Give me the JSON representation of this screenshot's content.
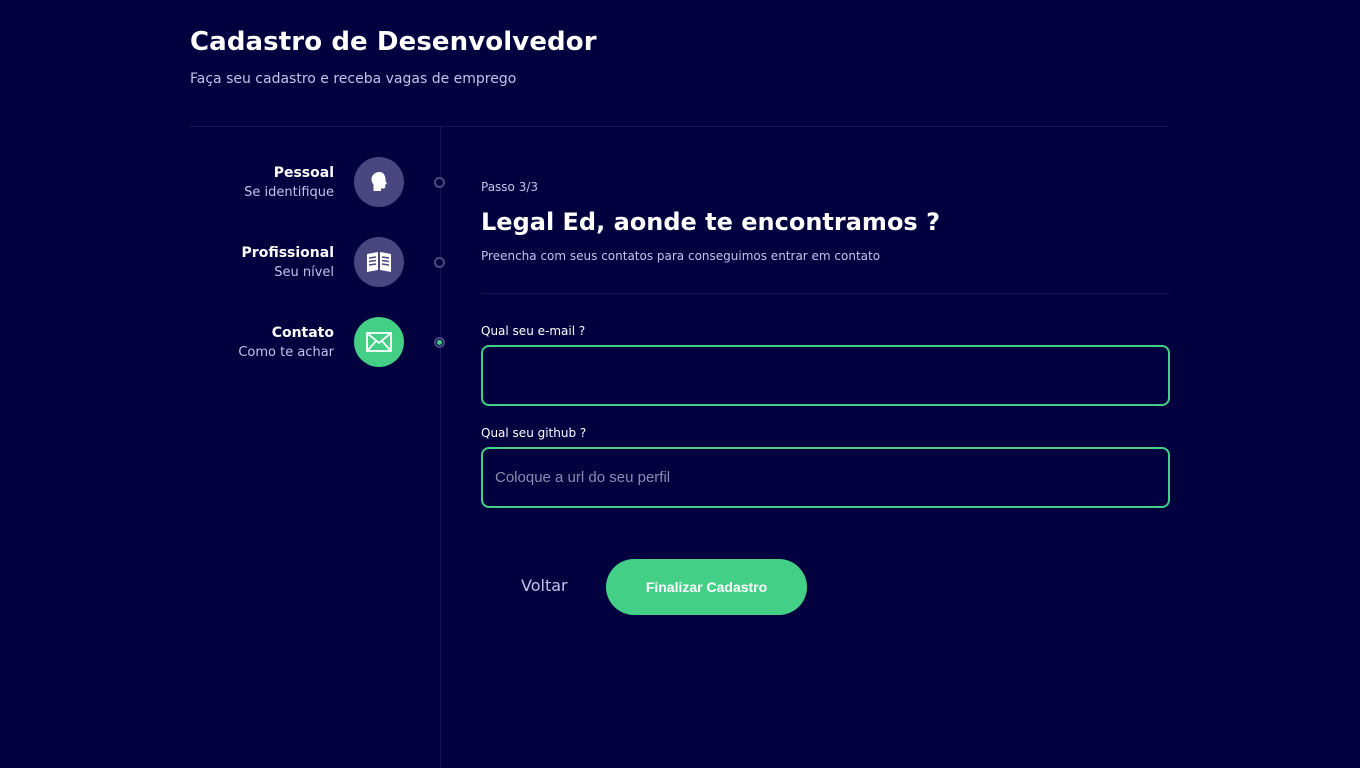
{
  "header": {
    "title": "Cadastro de Desenvolvedor",
    "subtitle": "Faça seu cadastro e receba vagas de emprego"
  },
  "steps": [
    {
      "title": "Pessoal",
      "subtitle": "Se identifique",
      "icon": "head-icon",
      "active": false
    },
    {
      "title": "Profissional",
      "subtitle": "Seu nível",
      "icon": "book-icon",
      "active": false
    },
    {
      "title": "Contato",
      "subtitle": "Como te achar",
      "icon": "envelope-icon",
      "active": true
    }
  ],
  "form": {
    "step_count": "Passo 3/3",
    "title": "Legal Ed, aonde te encontramos ?",
    "description": "Preencha com seus contatos para conseguimos entrar em contato",
    "email": {
      "label": "Qual seu e-mail ?",
      "value": "",
      "placeholder": ""
    },
    "github": {
      "label": "Qual seu github ?",
      "value": "",
      "placeholder": "Coloque a url do seu perfil"
    }
  },
  "actions": {
    "back_label": "Voltar",
    "finish_label": "Finalizar Cadastro"
  },
  "colors": {
    "background": "#02003f",
    "accent": "#43d086",
    "muted_icon": "#4a4780",
    "muted_text": "#c4c2e8"
  }
}
